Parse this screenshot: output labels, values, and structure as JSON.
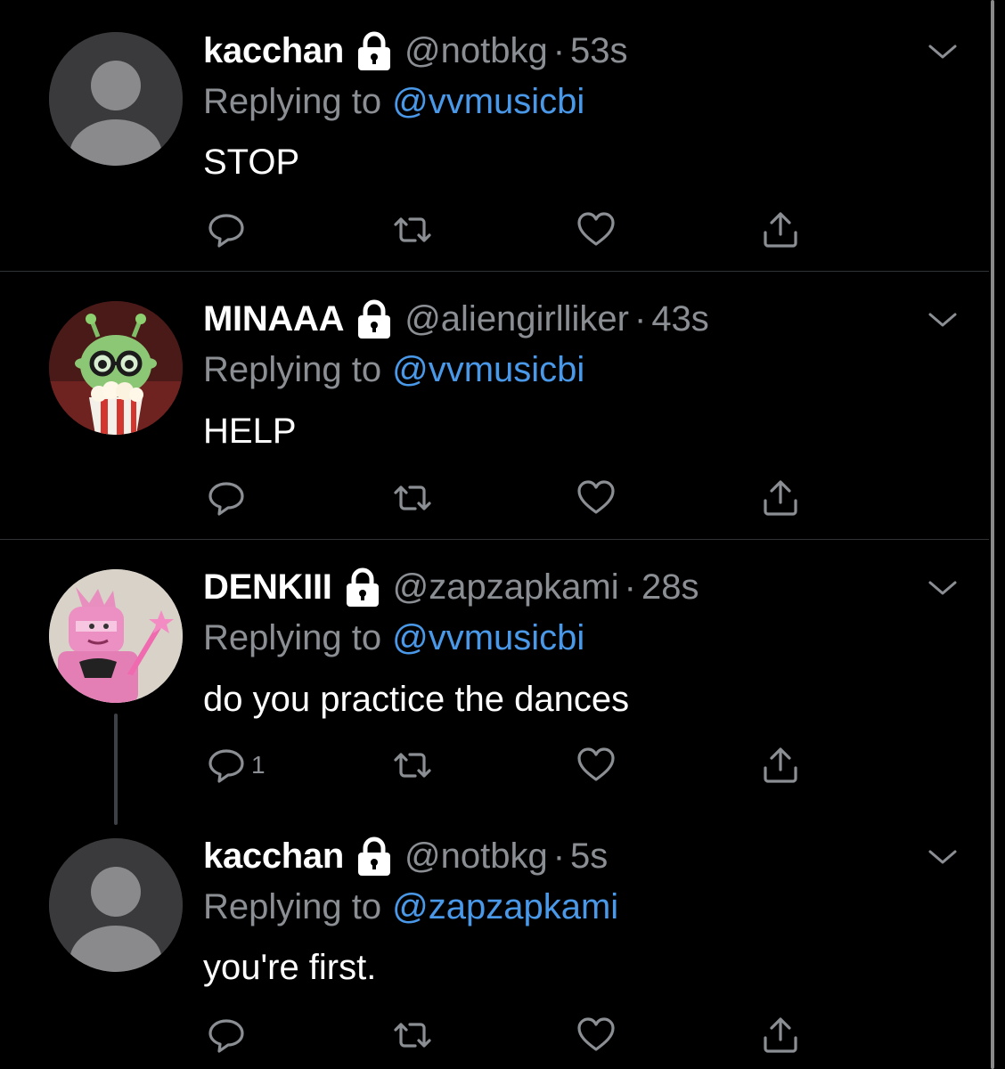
{
  "tweets": [
    {
      "display_name": "kacchan",
      "handle": "@notbkg",
      "separator": "·",
      "time": "53s",
      "reply_prefix": "Replying to",
      "reply_to": "@vvmusicbi",
      "text": "STOP",
      "avatar": "default-avatar",
      "locked": true,
      "reply_count": ""
    },
    {
      "display_name": "MINAAA",
      "handle": "@aliengirlliker",
      "separator": "·",
      "time": "43s",
      "reply_prefix": "Replying to",
      "reply_to": "@vvmusicbi",
      "text": "HELP",
      "avatar": "alien-popcorn-avatar",
      "locked": true,
      "reply_count": ""
    },
    {
      "display_name": "DENKIII",
      "handle": "@zapzapkami",
      "separator": "·",
      "time": "28s",
      "reply_prefix": "Replying to",
      "reply_to": "@vvmusicbi",
      "text": "do you practice the dances",
      "avatar": "pink-figure-avatar",
      "locked": true,
      "reply_count": "1"
    },
    {
      "display_name": "kacchan",
      "handle": "@notbkg",
      "separator": "·",
      "time": "5s",
      "reply_prefix": "Replying to",
      "reply_to": "@zapzapkami",
      "text": "you're first.",
      "avatar": "default-avatar",
      "locked": true,
      "reply_count": ""
    }
  ],
  "icons": {
    "reply": "reply-icon",
    "retweet": "retweet-icon",
    "like": "heart-icon",
    "share": "share-icon",
    "more": "chevron-down-icon",
    "protected": "lock-icon"
  },
  "colors": {
    "background": "#000000",
    "primary_text": "#ffffff",
    "secondary_text": "#8b8f94",
    "link": "#4a99e9",
    "divider": "#2f3336"
  }
}
